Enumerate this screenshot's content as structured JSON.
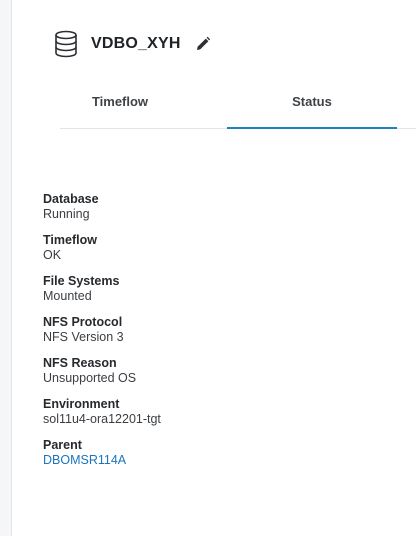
{
  "header": {
    "title": "VDBO_XYH",
    "icon": "database-icon",
    "edit_icon": "pencil-icon"
  },
  "tabs": [
    {
      "label": "Timeflow",
      "active": false
    },
    {
      "label": "Status",
      "active": true
    }
  ],
  "colors": {
    "accent": "#1e7fc1",
    "link": "#1b75bb"
  },
  "properties": [
    {
      "label": "Database",
      "value": "Running"
    },
    {
      "label": "Timeflow",
      "value": "OK"
    },
    {
      "label": "File Systems",
      "value": "Mounted"
    },
    {
      "label": "NFS Protocol",
      "value": "NFS Version 3"
    },
    {
      "label": "NFS Reason",
      "value": "Unsupported OS"
    },
    {
      "label": "Environment",
      "value": "sol11u4-ora12201-tgt"
    },
    {
      "label": "Parent",
      "value": "DBOMSR114A",
      "link": true
    }
  ]
}
